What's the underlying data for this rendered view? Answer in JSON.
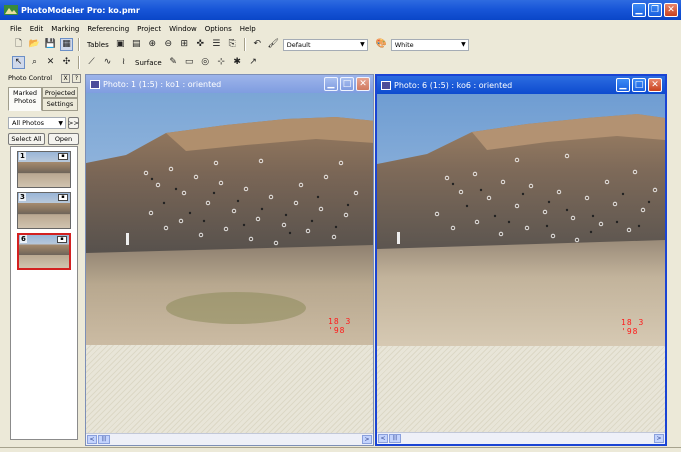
{
  "app": {
    "title": "PhotoModeler Pro: ko.pmr",
    "colors": {
      "titlebar": "#1856d8",
      "menu_bg": "#ece9d8",
      "selected_border": "#d32020",
      "stamp": "#ff1a1a"
    }
  },
  "menu": [
    "File",
    "Edit",
    "Marking",
    "Referencing",
    "Project",
    "Window",
    "Options",
    "Help"
  ],
  "toolbar1": {
    "tables_label": "Tables",
    "style_combo_value": "Default",
    "color_combo_value": "White"
  },
  "toolbar2": {
    "surface_label": "Surface"
  },
  "photo_control": {
    "title": "Photo Control",
    "close_glyph": "X",
    "help_glyph": "?",
    "tabs": [
      "Marked Photos",
      "Projected",
      "Settings"
    ],
    "filter_value": "All Photos",
    "more_label": ">>",
    "select_all_label": "Select All",
    "open_label": "Open",
    "thumbnails": [
      {
        "number": "1",
        "icon": "oriented-icon",
        "selected": false
      },
      {
        "number": "3",
        "icon": "oriented-icon",
        "selected": false
      },
      {
        "number": "6",
        "icon": "oriented-icon",
        "selected": true
      }
    ]
  },
  "photo_windows": [
    {
      "title": "Photo: 1 (1:5) : ko1 : oriented",
      "stamp": "18  3 '98",
      "active": false
    },
    {
      "title": "Photo: 6 (1:5) : ko6 : oriented",
      "stamp": "18  3 '98",
      "active": true
    }
  ],
  "scrollbar": {
    "left_arrow": "<",
    "right_arrow": ">",
    "grip": "|||"
  }
}
